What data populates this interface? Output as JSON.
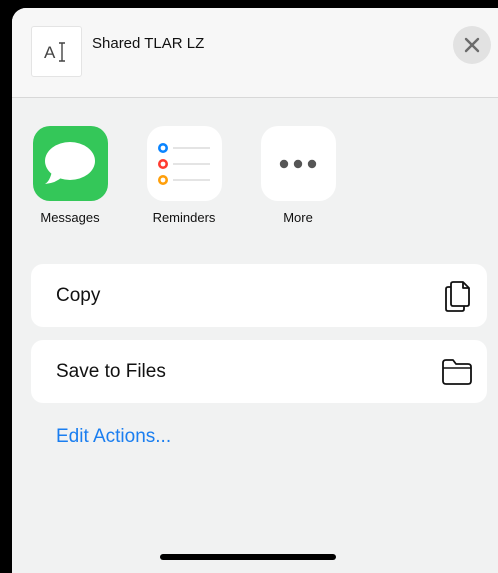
{
  "header": {
    "thumb_text": "AI",
    "title": "Shared TLAR LZ",
    "close_icon": "close-icon"
  },
  "apps": [
    {
      "label": "Messages",
      "icon": "messages-icon"
    },
    {
      "label": "Reminders",
      "icon": "reminders-icon"
    },
    {
      "label": "More",
      "icon": "more-icon"
    }
  ],
  "actions": [
    {
      "label": "Copy",
      "icon": "copy-icon"
    },
    {
      "label": "Save to Files",
      "icon": "folder-icon"
    }
  ],
  "edit_actions_label": "Edit Actions...",
  "colors": {
    "accent": "#1a7ef0",
    "messages_green": "#34c759",
    "reminder_blue": "#0a84ff",
    "reminder_red": "#ff3b30",
    "reminder_orange": "#ff9f0a"
  }
}
